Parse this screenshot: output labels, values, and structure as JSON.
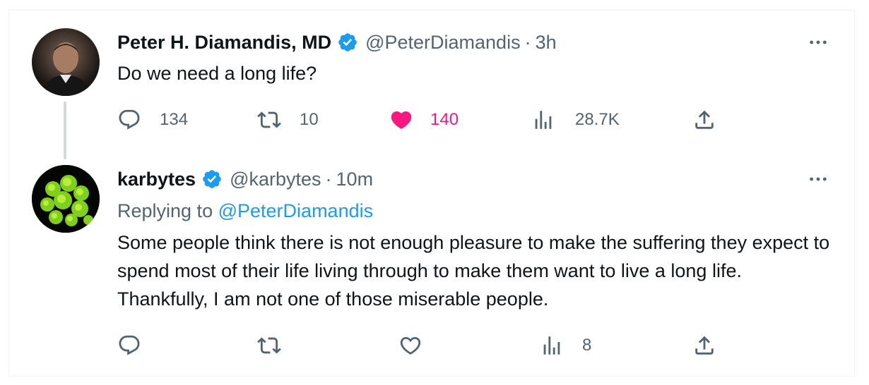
{
  "tweets": [
    {
      "display_name": "Peter H. Diamandis, MD",
      "handle": "@PeterDiamandis",
      "separator": "·",
      "time": "3h",
      "text": "Do we need a long life?",
      "actions": {
        "reply_count": "134",
        "retweet_count": "10",
        "like_count": "140",
        "views_count": "28.7K"
      },
      "liked": true
    },
    {
      "display_name": "karbytes",
      "handle": "@karbytes",
      "separator": "·",
      "time": "10m",
      "replying_label": "Replying to",
      "replying_mention": "@PeterDiamandis",
      "text": "Some people think there is not enough pleasure to make the suffering they expect to spend most of their life living through to make them want to live a long life. Thankfully, I am not one of those miserable people.",
      "actions": {
        "reply_count": "",
        "retweet_count": "",
        "like_count": "",
        "views_count": "8"
      },
      "liked": false
    }
  ],
  "colors": {
    "accent_blue": "#1d9bf0",
    "like_pink": "#f91880",
    "secondary_text": "#536471",
    "primary_text": "#0f1419",
    "thread_line": "#cfd9de"
  },
  "icons": [
    "verified-badge-icon",
    "more-options-icon",
    "reply-icon",
    "retweet-icon",
    "like-icon",
    "views-icon",
    "share-icon"
  ]
}
